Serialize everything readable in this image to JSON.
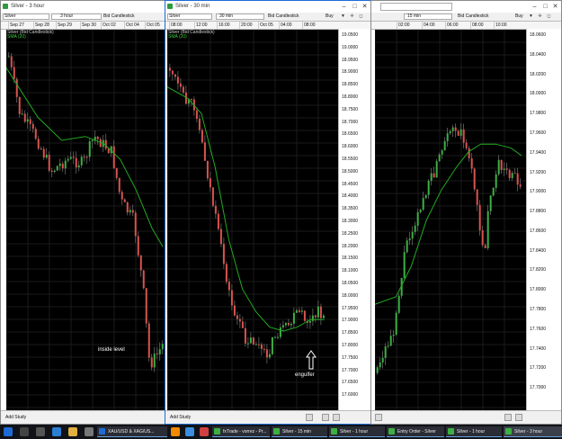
{
  "windows": {
    "w3h": {
      "title": "Silver - 3 hour",
      "symbol": "Silver",
      "interval": "3 hour",
      "chart_type": "Bid Candlestick",
      "legend_line1": "Silver (Bid Candlestick)",
      "legend_line2": "SMA (20)",
      "dates": [
        "Sep 27",
        "Sep 28",
        "Sep 29",
        "Sep 30",
        "Oct 02",
        "Oct 04",
        "Oct 05"
      ],
      "annotation": "inside level",
      "add_study": "Add Study"
    },
    "w30": {
      "title": "Silver - 30 min",
      "symbol": "Silver",
      "interval": "30 min",
      "chart_type": "Bid Candlestick",
      "buy": "Buy",
      "legend_line1": "Silver (Bid Candlestick)",
      "legend_line2": "SMA (20)",
      "times": [
        "08:00",
        "12:00",
        "16:00",
        "20:00",
        "Oct 05",
        "04:00",
        "08:00"
      ],
      "yaxis": [
        "19.0500",
        "19.0000",
        "18.9500",
        "18.9000",
        "18.8500",
        "18.8000",
        "18.7500",
        "18.7000",
        "18.6500",
        "18.6000",
        "18.5500",
        "18.5000",
        "18.4500",
        "18.4000",
        "18.3500",
        "18.3000",
        "18.2500",
        "18.2000",
        "18.1500",
        "18.1000",
        "18.0500",
        "18.0000",
        "17.9500",
        "17.9000",
        "17.8500",
        "17.8000",
        "17.7500",
        "17.7000",
        "17.6500",
        "17.6000"
      ],
      "annotation": "engulfer",
      "add_study": "Add Study"
    },
    "w15": {
      "interval": "15 min",
      "chart_type": "Bid Candlestick",
      "buy": "Buy",
      "times": [
        "02:00",
        "04:00",
        "06:00",
        "08:00",
        "10:00"
      ],
      "yaxis": [
        "18.0600",
        "18.0400",
        "18.0200",
        "18.0000",
        "17.9800",
        "17.9600",
        "17.9400",
        "17.9200",
        "17.9000",
        "17.8800",
        "17.8600",
        "17.8400",
        "17.8200",
        "17.8000",
        "17.7800",
        "17.7600",
        "17.7400",
        "17.7200",
        "17.7000"
      ]
    }
  },
  "taskbar": {
    "items": [
      "XAU/USD & XAG/US...",
      "fxTrade - vorrez - Pr...",
      "Silver - 15 min",
      "Silver - 1 hour",
      "Entry Order - Silver",
      "Silver - 1 hour",
      "Silver - 3 hour"
    ]
  },
  "colors": {
    "bull": "#3cb043",
    "bear": "#d9534f",
    "sma": "#22aa22",
    "background": "#000000"
  }
}
